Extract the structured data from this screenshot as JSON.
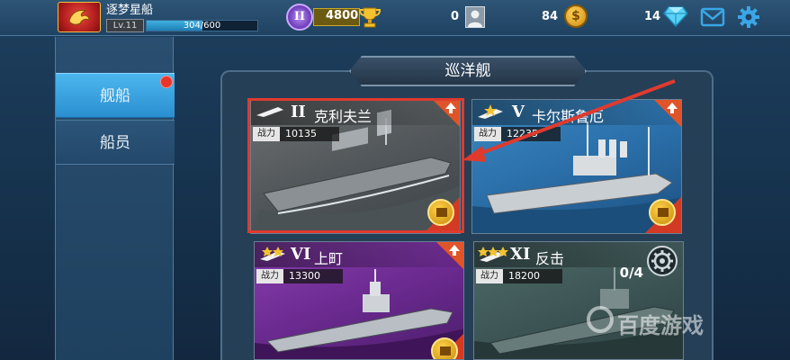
{
  "player": {
    "name": "逐梦星船",
    "level": "Lv.11",
    "xp_text": "304/600",
    "xp_fraction": 0.507
  },
  "resources": {
    "rank_badge": "II",
    "trophies": "4800",
    "crew_count": "0",
    "coins": "84",
    "gems": "14"
  },
  "sidebar": {
    "tabs": [
      {
        "label": "舰船",
        "active": true,
        "has_notification": true
      },
      {
        "label": "船员",
        "active": false
      }
    ]
  },
  "section": {
    "title": "巡洋舰"
  },
  "ships": [
    {
      "tier": "II",
      "name": "克利夫兰",
      "power_label": "战力",
      "power": "10135",
      "stars": 0,
      "upgrade": true,
      "medal": true,
      "selected": true,
      "color": "#5c6164"
    },
    {
      "tier": "V",
      "name": "卡尔斯鲁厄",
      "power_label": "战力",
      "power": "12235",
      "stars": 1,
      "upgrade": true,
      "medal": true,
      "color": "#2c71aa"
    },
    {
      "tier": "VI",
      "name": "上町",
      "power_label": "战力",
      "power": "13300",
      "stars": 2,
      "upgrade": true,
      "medal": true,
      "color": "#6b2a90"
    },
    {
      "tier": "XI",
      "name": "反击",
      "power_label": "战力",
      "power": "18200",
      "stars": 3,
      "upgrade": false,
      "parts": "0/4",
      "color": "#3e5656"
    }
  ],
  "watermark": "百度游戏",
  "icons": {
    "avatar": "dragon-emblem-icon",
    "trophy": "trophy-icon",
    "crew": "crew-portrait-icon",
    "coin": "gold-coin-icon",
    "gem": "diamond-icon",
    "mail": "mail-icon",
    "settings": "gear-icon"
  },
  "colors": {
    "accent_blue": "#3aa6e6",
    "highlight_red": "#e03a2e",
    "gold": "#f0c040"
  }
}
